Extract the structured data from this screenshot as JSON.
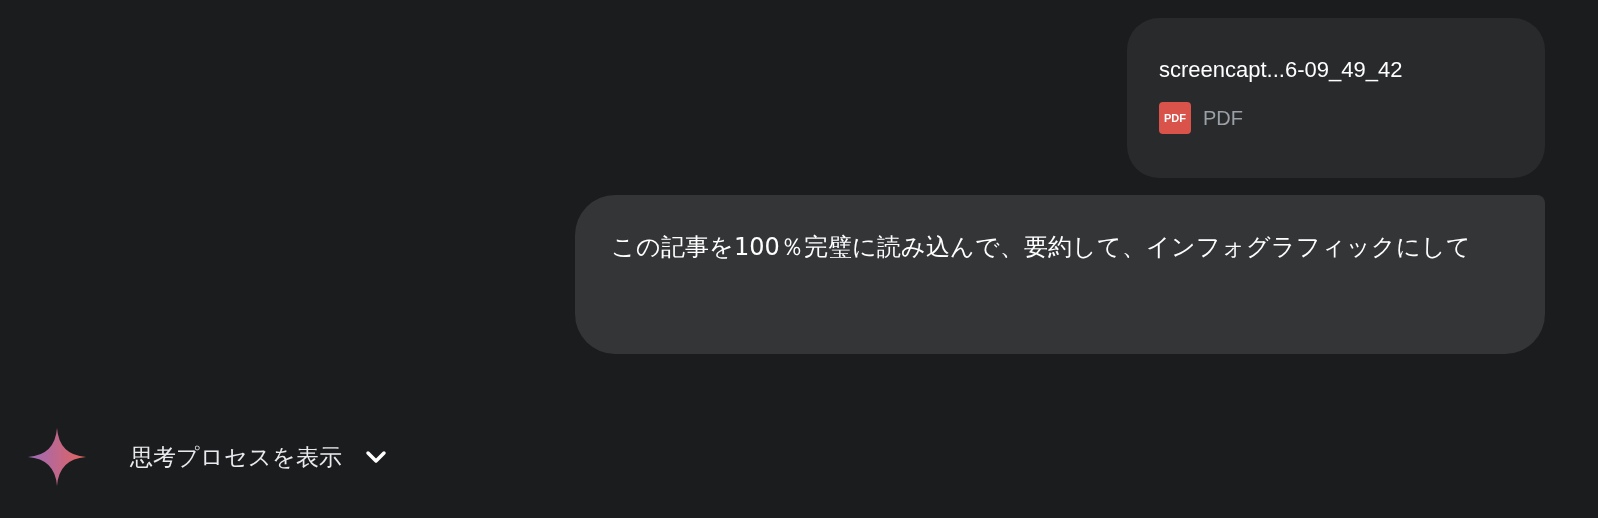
{
  "attachment": {
    "file_name": "screencapt...6-09_49_42",
    "file_type": "PDF",
    "type_badge": "PDF"
  },
  "message": {
    "text": "この記事を100％完璧に読み込んで、要約して、インフォグラフィックにして"
  },
  "thinking": {
    "label": "思考プロセスを表示",
    "expanded": false
  }
}
